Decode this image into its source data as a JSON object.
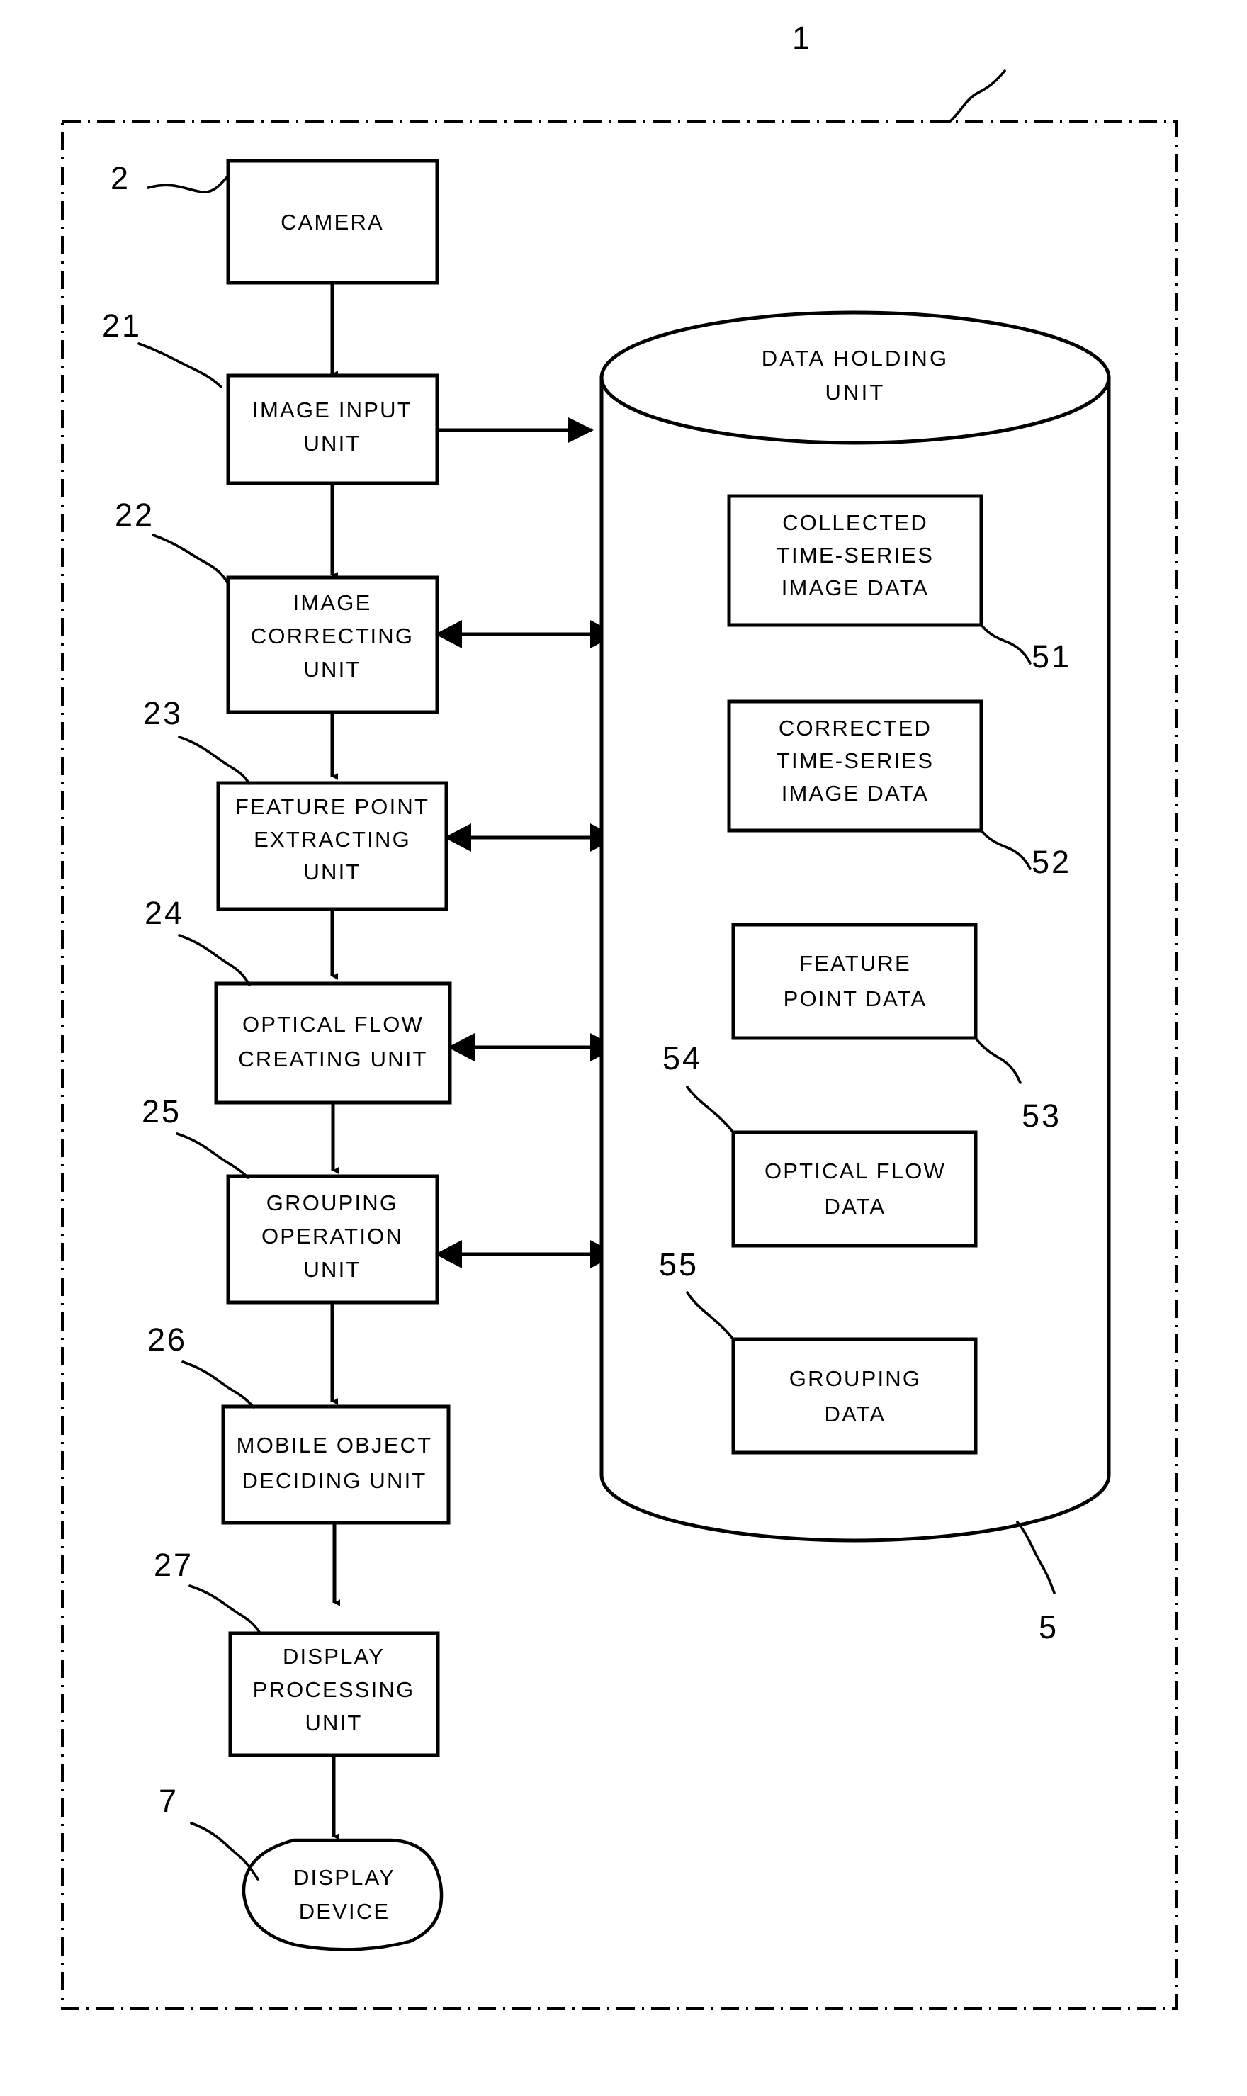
{
  "figure": {
    "system_ref": "1",
    "frame_style": "dash-dot-rectangle"
  },
  "process_chain": [
    {
      "ref": "2",
      "name": "camera",
      "lines": [
        "CAMERA"
      ],
      "shape": "rect",
      "bidirectional_to_store": false
    },
    {
      "ref": "21",
      "name": "image-input-unit",
      "lines": [
        "IMAGE INPUT",
        "UNIT"
      ],
      "shape": "rect",
      "bidirectional_to_store": false,
      "arrow_to_store": "single"
    },
    {
      "ref": "22",
      "name": "image-correcting-unit",
      "lines": [
        "IMAGE",
        "CORRECTING",
        "UNIT"
      ],
      "shape": "rect",
      "bidirectional_to_store": true
    },
    {
      "ref": "23",
      "name": "feature-point-extracting-unit",
      "lines": [
        "FEATURE POINT",
        "EXTRACTING",
        "UNIT"
      ],
      "shape": "rect",
      "bidirectional_to_store": true
    },
    {
      "ref": "24",
      "name": "optical-flow-creating-unit",
      "lines": [
        "OPTICAL FLOW",
        "CREATING UNIT"
      ],
      "shape": "rect",
      "bidirectional_to_store": true
    },
    {
      "ref": "25",
      "name": "grouping-operation-unit",
      "lines": [
        "GROUPING",
        "OPERATION",
        "UNIT"
      ],
      "shape": "rect",
      "bidirectional_to_store": true
    },
    {
      "ref": "26",
      "name": "mobile-object-deciding-unit",
      "lines": [
        "MOBILE OBJECT",
        "DECIDING UNIT"
      ],
      "shape": "rect",
      "bidirectional_to_store": false
    },
    {
      "ref": "27",
      "name": "display-processing-unit",
      "lines": [
        "DISPLAY",
        "PROCESSING",
        "UNIT"
      ],
      "shape": "rect",
      "bidirectional_to_store": false
    },
    {
      "ref": "7",
      "name": "display-device",
      "lines": [
        "DISPLAY",
        "DEVICE"
      ],
      "shape": "rounded",
      "bidirectional_to_store": false
    }
  ],
  "data_store": {
    "ref": "5",
    "name": "data-holding-unit",
    "title_lines": [
      "DATA HOLDING",
      "UNIT"
    ],
    "records": [
      {
        "ref": "51",
        "name": "collected-time-series-image-data",
        "lines": [
          "COLLECTED",
          "TIME-SERIES",
          "IMAGE DATA"
        ]
      },
      {
        "ref": "52",
        "name": "corrected-time-series-image-data",
        "lines": [
          "CORRECTED",
          "TIME-SERIES",
          "IMAGE DATA"
        ]
      },
      {
        "ref": "53",
        "name": "feature-point-data",
        "lines": [
          "FEATURE",
          "POINT DATA"
        ]
      },
      {
        "ref": "54",
        "name": "optical-flow-data",
        "lines": [
          "OPTICAL FLOW",
          "DATA"
        ]
      },
      {
        "ref": "55",
        "name": "grouping-data",
        "lines": [
          "GROUPING",
          "DATA"
        ]
      }
    ]
  },
  "colors": {
    "ink": "#000000",
    "paper": "#ffffff"
  }
}
